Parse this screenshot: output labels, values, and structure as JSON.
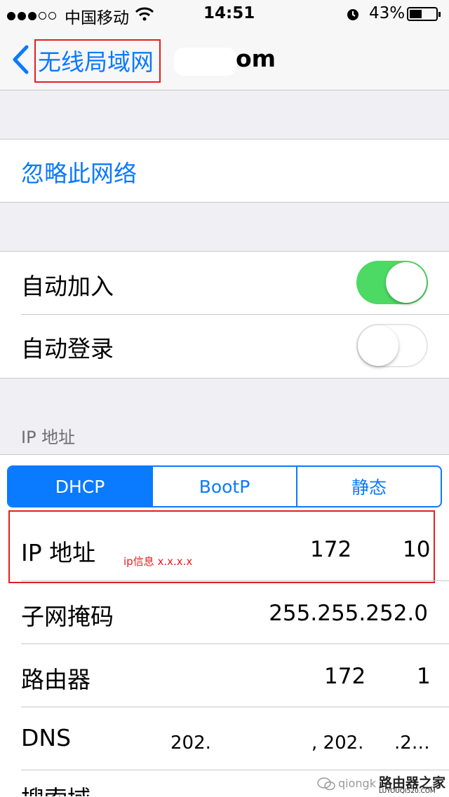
{
  "status_bar": {
    "carrier": "中国移动",
    "time": "14:51",
    "battery": "43%"
  },
  "nav": {
    "back_label": "无线局域网",
    "title": "om"
  },
  "forget_network": "忽略此网络",
  "toggles": [
    {
      "label": "自动加入",
      "state": "on"
    },
    {
      "label": "自动登录",
      "state": "off"
    }
  ],
  "ip_section": {
    "header": "IP 地址",
    "segments": [
      "DHCP",
      "BootP",
      "静态"
    ],
    "selected_segment": "DHCP",
    "annotation": "ip信息 x.x.x.x",
    "rows": {
      "ip": {
        "label": "IP 地址",
        "value_a": "172",
        "value_b": "10"
      },
      "subnet": {
        "label": "子网掩码",
        "value": "255.255.252.0"
      },
      "router": {
        "label": "路由器",
        "value_a": "172",
        "value_b": "1"
      },
      "dns": {
        "label": "DNS",
        "value_a": "202.",
        "value_b": ", 202.",
        "value_c": ".2…"
      },
      "search": {
        "label": "搜索域"
      }
    }
  },
  "watermark": {
    "account": "qiongk",
    "brand": "路由器之家",
    "domain": "LUYOUQI520.COM"
  },
  "colors": {
    "accent": "#0a7aff",
    "toggle_on": "#4cd964",
    "annotation": "#e02020"
  }
}
